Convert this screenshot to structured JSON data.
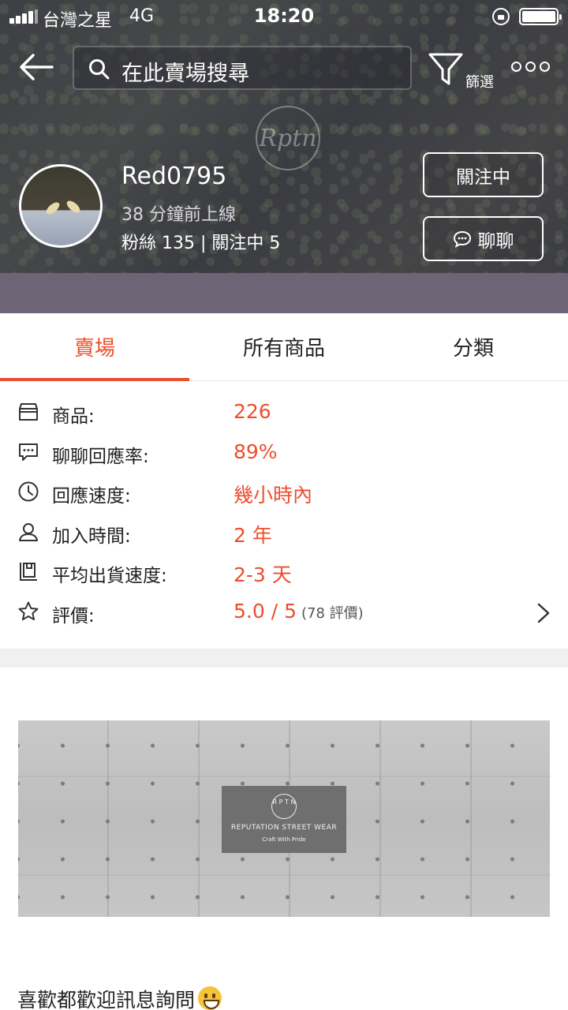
{
  "status_bar": {
    "carrier": "台灣之星",
    "network": "4G",
    "time": "18:20"
  },
  "header": {
    "search_placeholder": "在此賣場搜尋",
    "filter_label": "篩選"
  },
  "shop": {
    "name": "Red0795",
    "last_online": "38 分鐘前上線",
    "follow_stats": "粉絲 135 | 關注中 5",
    "following_button": "關注中",
    "chat_button": "聊聊"
  },
  "tabs": [
    {
      "label": "賣場",
      "active": true
    },
    {
      "label": "所有商品",
      "active": false
    },
    {
      "label": "分類",
      "active": false
    }
  ],
  "info": {
    "products": {
      "label": "商品:",
      "value": "226",
      "icon": "store-icon"
    },
    "chat_rate": {
      "label": "聊聊回應率:",
      "value": "89%",
      "icon": "chat-bubble-icon"
    },
    "response_speed": {
      "label": "回應速度:",
      "value": "幾小時內",
      "icon": "clock-icon"
    },
    "joined": {
      "label": "加入時間:",
      "value": "2 年",
      "icon": "person-icon"
    },
    "ship_speed": {
      "label": "平均出貨速度:",
      "value": "2-3 天",
      "icon": "box-icon"
    },
    "rating": {
      "label": "評價:",
      "value": "5.0 / 5",
      "sub": "(78 評價)",
      "icon": "star-icon"
    }
  },
  "cover": {
    "sign_letters": "R P T N",
    "sign_title": "REPUTATION STREET WEAR",
    "sign_sub": "Craft With Pride"
  },
  "description": "喜歡都歡迎訊息詢問",
  "colors": {
    "accent": "#ee4d2d",
    "banner": "#6d6575"
  }
}
